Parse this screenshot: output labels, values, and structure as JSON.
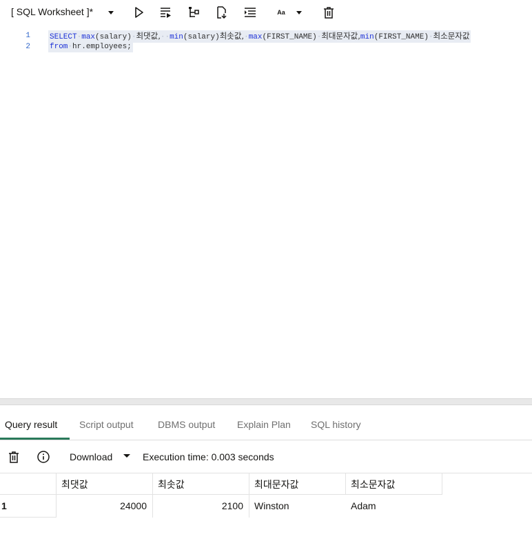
{
  "toolbar": {
    "worksheet_title": "[ SQL Worksheet ]*",
    "icons": [
      "chevron-down-icon",
      "run-icon",
      "run-script-icon",
      "explain-plan-icon",
      "download-script-icon",
      "format-icon",
      "font-size-icon",
      "chevron-down-icon",
      "trash-icon"
    ],
    "font_label": "Aa"
  },
  "editor": {
    "lines": [
      {
        "number": "1",
        "text": "SELECT max(salary) 최댓값,  min(salary)최솟값, max(FIRST_NAME) 최대문자값,min(FIRST_NAME) 최소문자값"
      },
      {
        "number": "2",
        "text": "from hr.employees;"
      }
    ],
    "line1": {
      "t1": "SELECT",
      "t2": "max",
      "t3": "(salary)",
      "t4": "최댓값,",
      "t5": "min",
      "t6": "(salary)",
      "t7": "최솟값,",
      "t8": "max",
      "t9": "(FIRST_NAME)",
      "t10": "최대문자값,",
      "t11": "min",
      "t12": "(FIRST_NAME)",
      "t13": "최소문자값"
    },
    "line2": {
      "t1": "from",
      "t2": "hr.employees;"
    }
  },
  "tabs": [
    {
      "label": "Query result",
      "active": true
    },
    {
      "label": "Script output",
      "active": false
    },
    {
      "label": "DBMS output",
      "active": false
    },
    {
      "label": "Explain Plan",
      "active": false
    },
    {
      "label": "SQL history",
      "active": false
    }
  ],
  "result_bar": {
    "download_label": "Download",
    "execution_time": "Execution time: 0.003 seconds"
  },
  "grid": {
    "columns": [
      "최댓값",
      "최솟값",
      "최대문자값",
      "최소문자값"
    ],
    "rows": [
      {
        "row_number": "1",
        "cells": [
          "24000",
          "2100",
          "Winston",
          "Adam"
        ]
      }
    ]
  },
  "colors": {
    "accent": "#2a7a5a",
    "keyword": "#1b2fd6",
    "line_number": "#2e64c9"
  }
}
